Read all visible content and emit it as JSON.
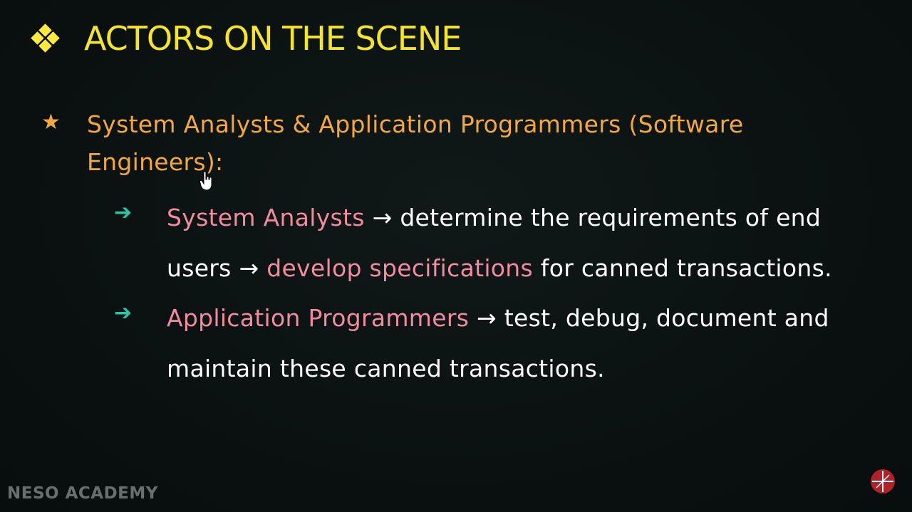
{
  "slide": {
    "title": "ACTORS ON THE SCENE",
    "main_bullet": {
      "text": "System Analysts & Application Programmers (Software Engineers):"
    },
    "sub_bullets": [
      {
        "term": "System Analysts",
        "arrow1": " → ",
        "part1": "determine the requirements of end users",
        "arrow2": " → ",
        "term2": "develop specifications",
        "part2": " for canned transactions."
      },
      {
        "term": "Application Programmers",
        "arrow1": " → ",
        "part1": "test, debug, document and maintain these canned transactions."
      }
    ]
  },
  "footer": {
    "brand": "NESO ACADEMY"
  },
  "icons": {
    "title_bullet": "four-diamond-icon",
    "main_bullet": "star-icon",
    "sub_bullet": "right-arrow-icon",
    "cursor": "hand-pointer-icon",
    "corner_logo": "neso-logo-icon"
  },
  "colors": {
    "background": "#0b1212",
    "title": "#f5e52a",
    "main_bullet": "#f4a83a",
    "highlight": "#f28aa0",
    "arrow": "#2bc4a4",
    "body": "#ffffff"
  }
}
